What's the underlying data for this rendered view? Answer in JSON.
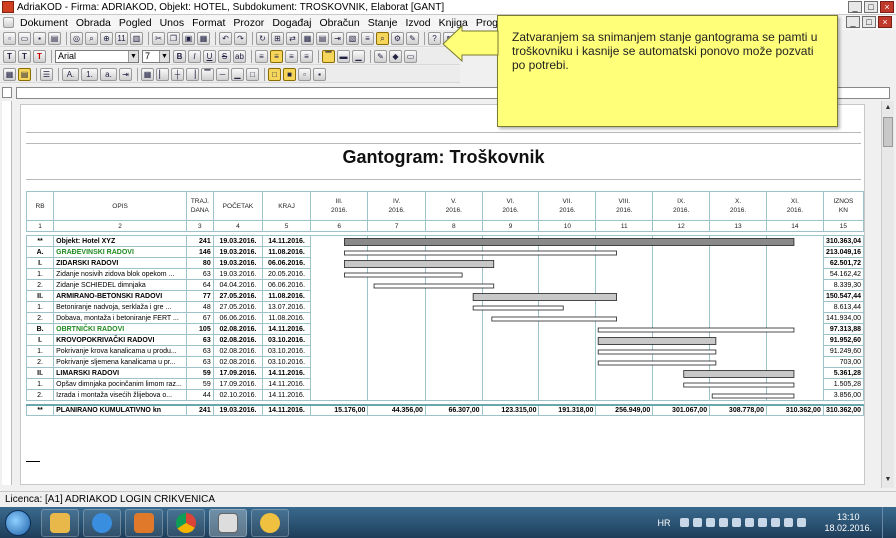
{
  "window": {
    "title": "AdriaKOD - Firma: ADRIAKOD,  Objekt: HOTEL,  Subdokument: TROŠKOVNIK,  Elaborat [GANT]",
    "min": "_",
    "max": "□",
    "close": "×"
  },
  "menu": [
    "Dokument",
    "Obrada",
    "Pogled",
    "Unos",
    "Format",
    "Prozor",
    "Događaj",
    "Obračun",
    "Stanje",
    "Izvod",
    "Knjiga",
    "Program"
  ],
  "toolbar": {
    "font": "Arial",
    "size": "7",
    "bold": "B",
    "italic": "I",
    "underline": "U",
    "strike": "S",
    "t_big": "T",
    "t_mid": "T",
    "t_red": "T",
    "a1": "A.",
    "a2": "1.",
    "a3": "a.",
    "tb11": "11"
  },
  "callout": "Zatvaranjem sa snimanjem stanje gantograma se pamti u troškovniku i kasnije se automatski ponovo može pozvati po potrebi.",
  "gantt": {
    "title": "Gantogram: Troškovnik",
    "headers": {
      "rb": "RB",
      "opis": "OPIS",
      "traj": "TRAJ.\nDANA",
      "pocetak": "POČETAK",
      "kraj": "KRAJ",
      "iznos": "IZNOS\nKN"
    },
    "months": [
      "III.\n2016.",
      "IV.\n2016.",
      "V.\n2016.",
      "VI.\n2016.",
      "VII.\n2016.",
      "VIII.\n2016.",
      "IX.\n2016.",
      "X.\n2016.",
      "XI.\n2016."
    ],
    "col_numbers": [
      "1",
      "2",
      "3",
      "4",
      "5",
      "6",
      "7",
      "8",
      "9",
      "10",
      "11",
      "12",
      "13",
      "14",
      "15"
    ],
    "rows": [
      {
        "rb": "**",
        "opis": "Objekt: Hotel XYZ",
        "traj": "241",
        "pocetak": "19.03.2016.",
        "kraj": "14.11.2016.",
        "iznos": "310.363,04",
        "style": "bold",
        "bar": "dark",
        "start": [
          3,
          19
        ],
        "end": [
          11,
          14
        ]
      },
      {
        "rb": "A.",
        "opis": "GRAĐEVINSKI RADOVI",
        "traj": "146",
        "pocetak": "19.03.2016.",
        "kraj": "11.08.2016.",
        "iznos": "213.049,16",
        "style": "green",
        "bar": "white",
        "start": [
          3,
          19
        ],
        "end": [
          8,
          11
        ]
      },
      {
        "rb": "I.",
        "opis": "ZIDARSKI RADOVI",
        "traj": "80",
        "pocetak": "19.03.2016.",
        "kraj": "06.06.2016.",
        "iznos": "62.501,72",
        "style": "bold",
        "bar": "gray",
        "start": [
          3,
          19
        ],
        "end": [
          6,
          6
        ]
      },
      {
        "rb": "1.",
        "opis": "Zidanje nosivih zidova blok opekom ...",
        "traj": "63",
        "pocetak": "19.03.2016.",
        "kraj": "20.05.2016.",
        "iznos": "54.162,42",
        "style": "normal",
        "bar": "white",
        "start": [
          3,
          19
        ],
        "end": [
          5,
          20
        ]
      },
      {
        "rb": "2.",
        "opis": "Zidanje SCHIEDEL dimnjaka",
        "traj": "64",
        "pocetak": "04.04.2016.",
        "kraj": "06.06.2016.",
        "iznos": "8.339,30",
        "style": "normal",
        "bar": "white",
        "start": [
          4,
          4
        ],
        "end": [
          6,
          6
        ]
      },
      {
        "rb": "II.",
        "opis": "ARMIRANO-BETONSKI RADOVI",
        "traj": "77",
        "pocetak": "27.05.2016.",
        "kraj": "11.08.2016.",
        "iznos": "150.547,44",
        "style": "bold",
        "bar": "gray",
        "start": [
          5,
          27
        ],
        "end": [
          8,
          11
        ]
      },
      {
        "rb": "1.",
        "opis": "Betoniranje nadvoja, serklaža i gre ...",
        "traj": "48",
        "pocetak": "27.05.2016.",
        "kraj": "13.07.2016.",
        "iznos": "8.613,44",
        "style": "normal",
        "bar": "white",
        "start": [
          5,
          27
        ],
        "end": [
          7,
          13
        ]
      },
      {
        "rb": "2.",
        "opis": "Dobava, montaža i betoniranje FERT ...",
        "traj": "67",
        "pocetak": "06.06.2016.",
        "kraj": "11.08.2016.",
        "iznos": "141.934,00",
        "style": "normal",
        "bar": "white",
        "start": [
          6,
          6
        ],
        "end": [
          8,
          11
        ]
      },
      {
        "rb": "B.",
        "opis": "OBRTNIČKI RADOVI",
        "traj": "105",
        "pocetak": "02.08.2016.",
        "kraj": "14.11.2016.",
        "iznos": "97.313,88",
        "style": "green",
        "bar": "white",
        "start": [
          8,
          2
        ],
        "end": [
          11,
          14
        ]
      },
      {
        "rb": "I.",
        "opis": "KROVOPOKRIVAČKI RADOVI",
        "traj": "63",
        "pocetak": "02.08.2016.",
        "kraj": "03.10.2016.",
        "iznos": "91.952,60",
        "style": "bold",
        "bar": "gray",
        "start": [
          8,
          2
        ],
        "end": [
          10,
          3
        ]
      },
      {
        "rb": "1.",
        "opis": "Pokrivanje krova kanalicama u produ...",
        "traj": "63",
        "pocetak": "02.08.2016.",
        "kraj": "03.10.2016.",
        "iznos": "91.249,60",
        "style": "normal",
        "bar": "white",
        "start": [
          8,
          2
        ],
        "end": [
          10,
          3
        ]
      },
      {
        "rb": "2.",
        "opis": "Pokrivanje sljemena kanalicama u pr...",
        "traj": "63",
        "pocetak": "02.08.2016.",
        "kraj": "03.10.2016.",
        "iznos": "703,00",
        "style": "normal",
        "bar": "white",
        "start": [
          8,
          2
        ],
        "end": [
          10,
          3
        ]
      },
      {
        "rb": "II.",
        "opis": "LIMARSKI RADOVI",
        "traj": "59",
        "pocetak": "17.09.2016.",
        "kraj": "14.11.2016.",
        "iznos": "5.361,28",
        "style": "bold",
        "bar": "gray",
        "start": [
          9,
          17
        ],
        "end": [
          11,
          14
        ]
      },
      {
        "rb": "1.",
        "opis": "Opšav dimnjaka pocinčanim limom raz...",
        "traj": "59",
        "pocetak": "17.09.2016.",
        "kraj": "14.11.2016.",
        "iznos": "1.505,28",
        "style": "normal",
        "bar": "white",
        "start": [
          9,
          17
        ],
        "end": [
          11,
          14
        ]
      },
      {
        "rb": "2.",
        "opis": "Izrada i montaža visećih žlijebova o...",
        "traj": "44",
        "pocetak": "02.10.2016.",
        "kraj": "14.11.2016.",
        "iznos": "3.856,00",
        "style": "normal",
        "bar": "white",
        "start": [
          10,
          2
        ],
        "end": [
          11,
          14
        ]
      }
    ],
    "total": {
      "rb": "**",
      "opis": "PLANIRANO KUMULATIVNO kn",
      "traj": "241",
      "pocetak": "19.03.2016.",
      "kraj": "14.11.2016.",
      "iznos": "310.362,00",
      "months": [
        "15.176,00",
        "44.356,00",
        "66.307,00",
        "123.315,00",
        "191.318,00",
        "256.949,00",
        "301.067,00",
        "308.778,00",
        "310.362,00"
      ]
    }
  },
  "status": "Licenca: [A1] ADRIAKOD LOGIN CRIKVENICA",
  "taskbar": {
    "lang": "HR",
    "time": "13:10",
    "date": "18.02.2016."
  },
  "colors": {
    "bar_dark": "#8a8a8a",
    "bar_gray": "#c8c8c8",
    "bar_white": "#ffffff",
    "green_text": "#1e8a1e",
    "callout_bg": "#ffff7a"
  }
}
